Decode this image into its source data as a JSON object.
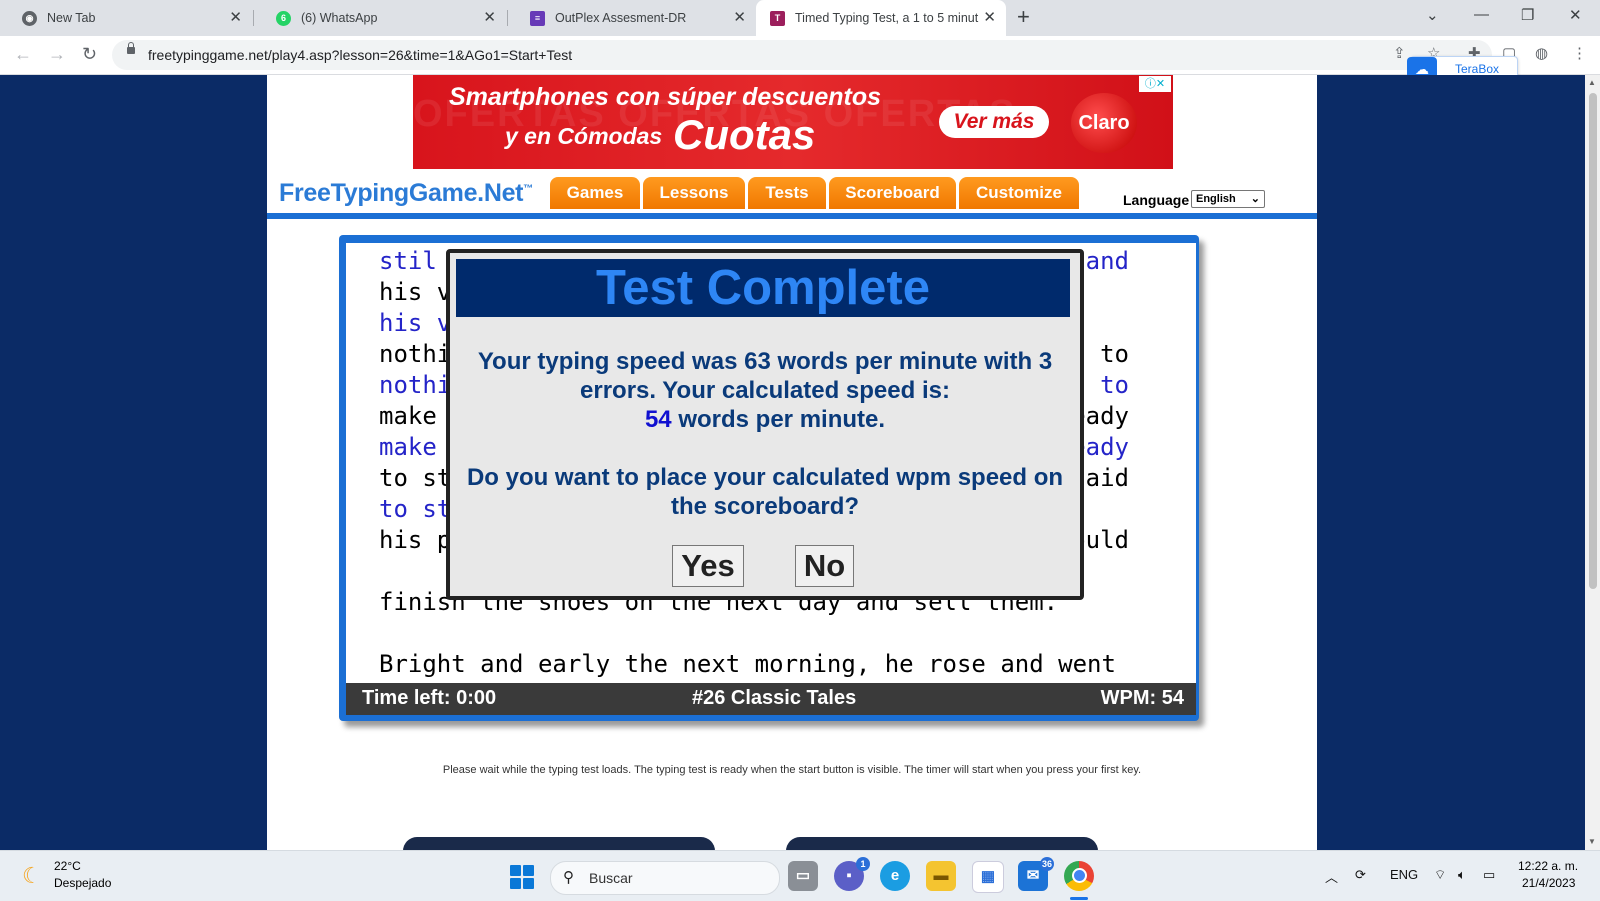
{
  "browser": {
    "tabs": [
      {
        "title": "New Tab",
        "active": false
      },
      {
        "title": "(6) WhatsApp",
        "active": false
      },
      {
        "title": "OutPlex Assesment-DR",
        "active": false
      },
      {
        "title": "Timed Typing Test, a 1 to 5 minut",
        "active": true
      }
    ],
    "url": "freetypinggame.net/play4.asp?lesson=26&time=1&AGo1=Start+Test",
    "terabox_label": "TeraBox"
  },
  "ad": {
    "line1": "Smartphones con súper descuentos",
    "line2a": "y en Cómodas",
    "line2b": "Cuotas",
    "cta": "Ver más",
    "brand": "Claro",
    "background_text": "OFERTAS OFERTAS OFERTAS"
  },
  "site": {
    "logo": "FreeTypingGame.Net",
    "logo_tm": "™",
    "nav": [
      "Games",
      "Lessons",
      "Tests",
      "Scoreboard",
      "Customize"
    ],
    "language_label": "Language",
    "language_value": "English"
  },
  "typing": {
    "lines": [
      {
        "text": "stil",
        "right": "and",
        "style": "typed"
      },
      {
        "text": "his v",
        "right": "",
        "style": "ref"
      },
      {
        "text": "his v",
        "right": "",
        "style": "typed"
      },
      {
        "text": "nothi",
        "right": "gh to",
        "style": "ref"
      },
      {
        "text": "nothi",
        "right": "gh to",
        "style": "typed"
      },
      {
        "text": "make",
        "right": "eady",
        "style": "ref"
      },
      {
        "text": "make",
        "right": "eady",
        "style": "typed"
      },
      {
        "text": "to st",
        "right": "said",
        "style": "ref"
      },
      {
        "text": "to st",
        "right": "",
        "style": "typed"
      },
      {
        "text": "his p",
        "right": "ould",
        "style": "ref"
      },
      {
        "text": "",
        "right": "",
        "style": "ref"
      },
      {
        "text": "finish the shoes on the next day and sell them.",
        "right": "",
        "style": "ref"
      },
      {
        "text": "",
        "right": "",
        "style": "ref"
      },
      {
        "text": "Bright and early the next morning, he rose and went",
        "right": "",
        "style": "ref"
      }
    ],
    "time_left": "Time left: 0:00",
    "lesson": "#26 Classic Tales",
    "wpm": "WPM: 54"
  },
  "modal": {
    "title": "Test Complete",
    "msg_part1": "Your typing speed was",
    "raw_wpm": "63",
    "msg_part2": "words per minute with",
    "errors": "3",
    "msg_part3": "errors. Your calculated speed is:",
    "calc_wpm": "54",
    "msg_part4": "words per minute.",
    "question": "Do you want to place your calculated wpm speed on the scoreboard?",
    "yes": "Yes",
    "no": "No"
  },
  "page_note": "Please wait while the typing test loads. The typing test is ready when the start button is visible. The timer will start when you press your first key.",
  "taskbar": {
    "weather_temp": "22°C",
    "weather_desc": "Despejado",
    "search_placeholder": "Buscar",
    "teams_badge": "1",
    "mail_badge": "36",
    "lang": "ENG",
    "time": "12:22 a. m.",
    "date": "21/4/2023"
  }
}
